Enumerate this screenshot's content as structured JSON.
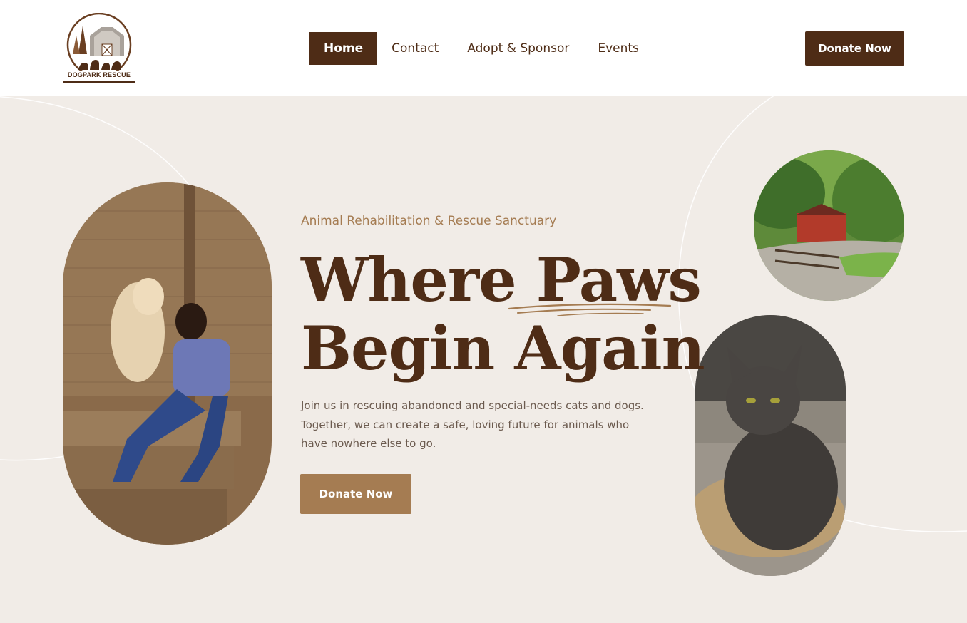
{
  "brand": {
    "logo_text": "DOGPARK RESCUE",
    "primary": "#4e2c16",
    "accent": "#a57c52",
    "bg": "#f1ece7"
  },
  "nav": {
    "items": [
      {
        "label": "Home",
        "active": true
      },
      {
        "label": "Contact"
      },
      {
        "label": "Adopt & Sponsor"
      },
      {
        "label": "Events"
      }
    ]
  },
  "header": {
    "donate_label": "Donate Now"
  },
  "hero": {
    "eyebrow": "Animal Rehabilitation & Rescue Sanctuary",
    "headline_line1": "Where Paws",
    "headline_line2": "Begin Again",
    "lede": "Join us in rescuing abandoned and special-needs cats and dogs. Together, we can create a safe, loving future for animals who have nowhere else to go.",
    "donate_label": "Donate Now"
  },
  "images": {
    "woman_dog": "woman-with-dog-photo",
    "farm": "red-barn-farm-photo",
    "cat": "gray-cat-photo"
  }
}
